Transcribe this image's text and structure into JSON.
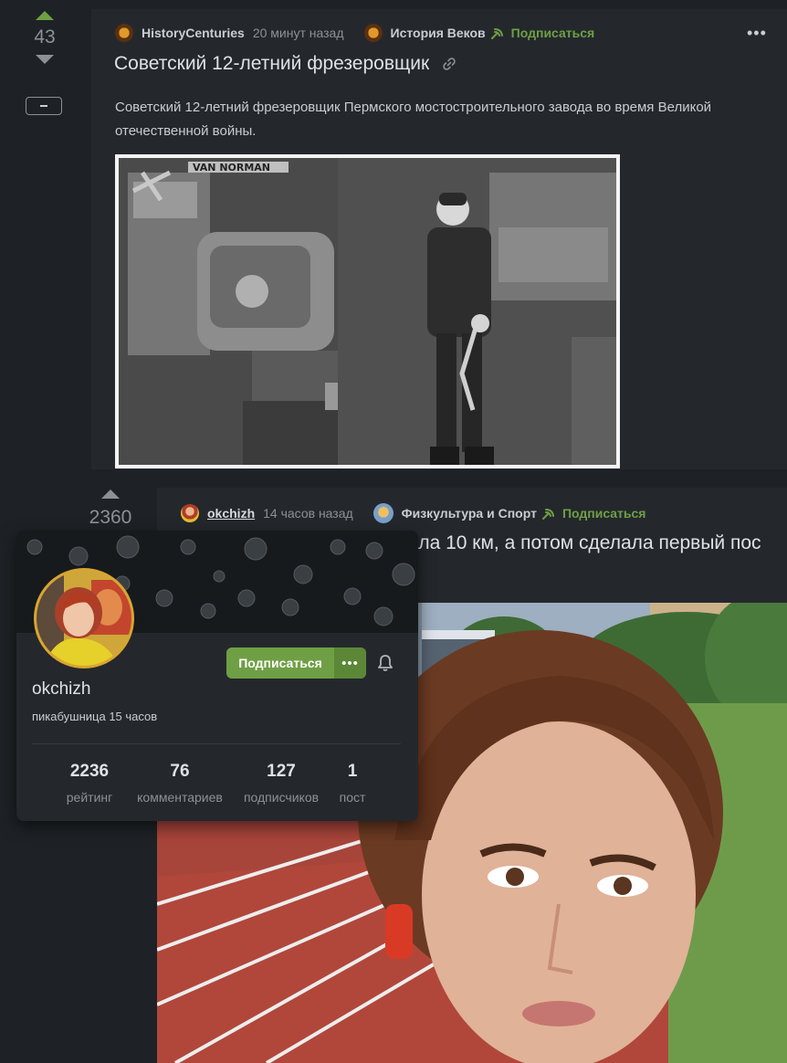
{
  "post1": {
    "rating": "43",
    "author": "HistoryCenturies",
    "time": "20 минут назад",
    "community": "История Веков",
    "subscribe_label": "Подписаться",
    "more_label": "•••",
    "title": "Советский 12-летний фрезеровщик",
    "text": "Советский 12-летний фрезеровщик Пермского мостостроительного завода во время Великой отечественной войны.",
    "image_caption": "VAN NORMAN"
  },
  "post2": {
    "rating": "2360",
    "author": "okchizh",
    "time": "14 часов назад",
    "community": "Физкультура и Спорт",
    "subscribe_label": "Подписаться",
    "title_visible": "кала 10 км, а потом сделала первый пос"
  },
  "profile_card": {
    "username": "okchizh",
    "subtitle": "пикабушница 15 часов",
    "subscribe_button": "Подписаться",
    "more_button": "•••",
    "stats": [
      {
        "value": "2236",
        "label": "рейтинг"
      },
      {
        "value": "76",
        "label": "комментариев"
      },
      {
        "value": "127",
        "label": "подписчиков"
      },
      {
        "value": "1",
        "label": "пост"
      }
    ]
  },
  "colors": {
    "accent_green": "#6f9f45",
    "background": "#1e2226",
    "card": "#24282c",
    "avatar_ring": "#d9a530"
  }
}
